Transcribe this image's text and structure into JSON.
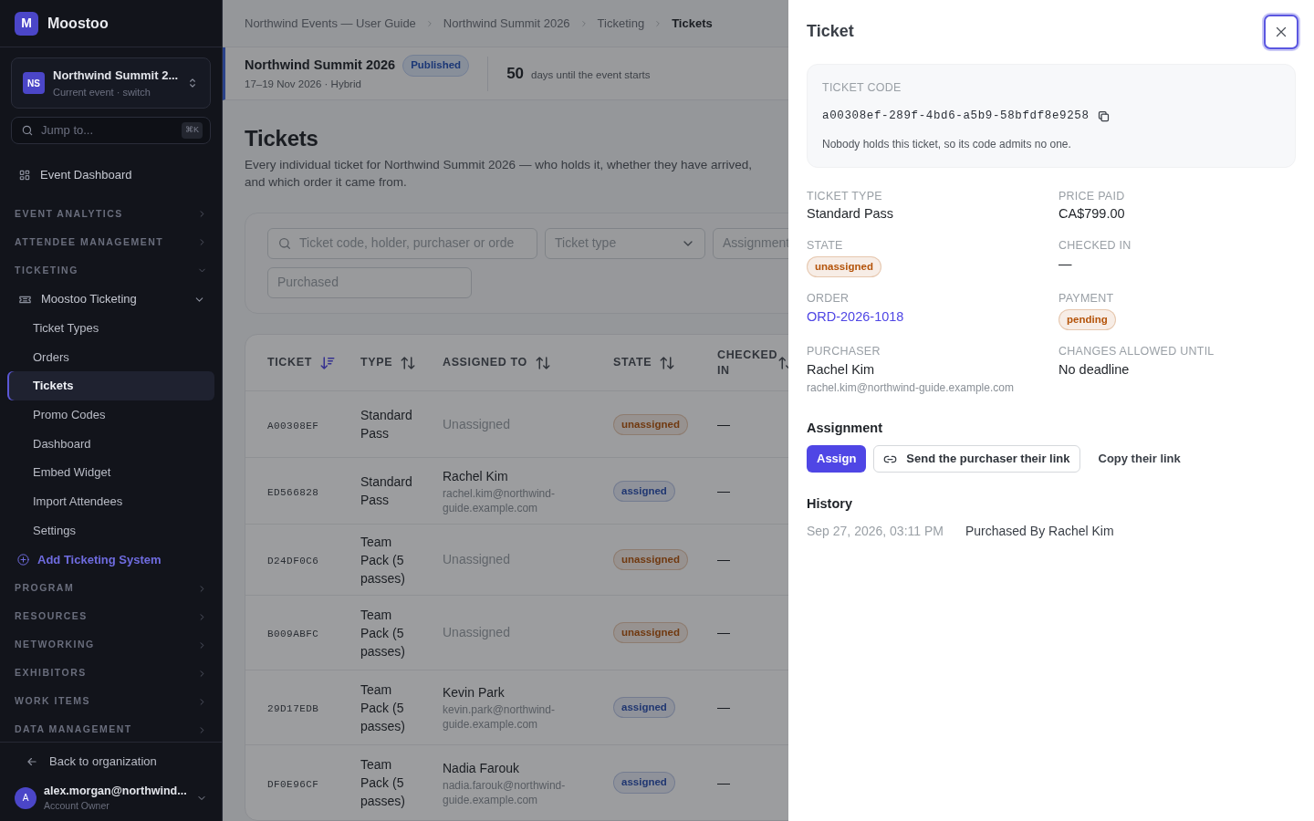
{
  "app": {
    "logo_letter": "M",
    "name": "Moostoo"
  },
  "event_switcher": {
    "initials": "NS",
    "name": "Northwind Summit 2...",
    "subtitle": "Current event · switch"
  },
  "jump": {
    "placeholder": "Jump to...",
    "shortcut": "⌘K"
  },
  "sidebar": {
    "items": [
      {
        "kind": "link",
        "label": "Event Dashboard"
      },
      {
        "kind": "section",
        "label": "EVENT ANALYTICS",
        "expanded": false
      },
      {
        "kind": "section",
        "label": "ATTENDEE MANAGEMENT",
        "expanded": false
      },
      {
        "kind": "section",
        "label": "TICKETING",
        "expanded": true,
        "children": [
          {
            "kind": "group",
            "label": "Moostoo Ticketing",
            "expanded": true,
            "children": [
              {
                "label": "Ticket Types",
                "selected": false
              },
              {
                "label": "Orders",
                "selected": false
              },
              {
                "label": "Tickets",
                "selected": true
              },
              {
                "label": "Promo Codes",
                "selected": false
              },
              {
                "label": "Dashboard",
                "selected": false
              },
              {
                "label": "Embed Widget",
                "selected": false
              },
              {
                "label": "Import Attendees",
                "selected": false
              },
              {
                "label": "Settings",
                "selected": false
              }
            ]
          },
          {
            "kind": "add",
            "label": "Add Ticketing System"
          }
        ]
      },
      {
        "kind": "section",
        "label": "PROGRAM",
        "expanded": false
      },
      {
        "kind": "section",
        "label": "RESOURCES",
        "expanded": false
      },
      {
        "kind": "section",
        "label": "NETWORKING",
        "expanded": false
      },
      {
        "kind": "section",
        "label": "EXHIBITORS",
        "expanded": false
      },
      {
        "kind": "section",
        "label": "WORK ITEMS",
        "expanded": false
      },
      {
        "kind": "section",
        "label": "DATA MANAGEMENT",
        "expanded": false
      }
    ]
  },
  "sidebar_footer": {
    "back": "Back to organization",
    "user": {
      "initial": "A",
      "email": "alex.morgan@northwind...",
      "role": "Account Owner"
    }
  },
  "breadcrumbs": [
    {
      "label": "Northwind Events — User Guide",
      "current": false
    },
    {
      "label": "Northwind Summit 2026",
      "current": false
    },
    {
      "label": "Ticketing",
      "current": false
    },
    {
      "label": "Tickets",
      "current": true
    }
  ],
  "event_bar": {
    "name": "Northwind Summit 2026",
    "status": "Published",
    "dates": "17–19 Nov 2026 · Hybrid",
    "countdown": "50",
    "countdown_label": "days until the event starts"
  },
  "page": {
    "title": "Tickets",
    "description": "Every individual ticket for Northwind Summit 2026 — who holds it, whether they have arrived, and which order it came from."
  },
  "filters": {
    "search_placeholder": "Ticket code, holder, purchaser or orde",
    "ticket_type_placeholder": "Ticket type",
    "assignment_placeholder": "Assignment",
    "purchased_placeholder": "Purchased"
  },
  "table": {
    "columns": [
      {
        "label": "TICKET",
        "sorted": true
      },
      {
        "label": "TYPE",
        "sorted": false
      },
      {
        "label": "ASSIGNED TO",
        "sorted": false
      },
      {
        "label": "STATE",
        "sorted": false
      },
      {
        "label": "CHECKED IN",
        "sorted": false
      }
    ],
    "rows": [
      {
        "code": "A00308EF",
        "type": "Standard Pass",
        "assigned": false,
        "assigned_to": "Unassigned",
        "state": "unassigned",
        "checked_in": "—"
      },
      {
        "code": "ED566828",
        "type": "Standard Pass",
        "assigned": true,
        "assigned_to": "Rachel Kim",
        "email": "rachel.kim@northwind-guide.example.com",
        "state": "assigned",
        "checked_in": "—"
      },
      {
        "code": "D24DF0C6",
        "type": "Team Pack (5 passes)",
        "assigned": false,
        "assigned_to": "Unassigned",
        "state": "unassigned",
        "checked_in": "—"
      },
      {
        "code": "B009ABFC",
        "type": "Team Pack (5 passes)",
        "assigned": false,
        "assigned_to": "Unassigned",
        "state": "unassigned",
        "checked_in": "—"
      },
      {
        "code": "29D17EDB",
        "type": "Team Pack (5 passes)",
        "assigned": true,
        "assigned_to": "Kevin Park",
        "email": "kevin.park@northwind-guide.example.com",
        "state": "assigned",
        "checked_in": "—"
      },
      {
        "code": "DF0E96CF",
        "type": "Team Pack (5 passes)",
        "assigned": true,
        "assigned_to": "Nadia Farouk",
        "email": "nadia.farouk@northwind-guide.example.com",
        "state": "assigned",
        "checked_in": "—"
      }
    ]
  },
  "drawer": {
    "title": "Ticket",
    "code_card": {
      "label": "TICKET CODE",
      "code": "a00308ef-289f-4bd6-a5b9-58bfdf8e9258",
      "note": "Nobody holds this ticket, so its code admits no one."
    },
    "details": [
      {
        "label": "TICKET TYPE",
        "kind": "text",
        "value": "Standard Pass"
      },
      {
        "label": "PRICE PAID",
        "kind": "text",
        "value": "CA$799.00"
      },
      {
        "label": "STATE",
        "kind": "badge",
        "color": "#b45309",
        "value": "unassigned"
      },
      {
        "label": "CHECKED IN",
        "kind": "text",
        "value": "—"
      },
      {
        "label": "ORDER",
        "kind": "link",
        "value": "ORD-2026-1018"
      },
      {
        "label": "PAYMENT",
        "kind": "badge",
        "color": "#b45309",
        "value": "pending"
      },
      {
        "label": "PURCHASER",
        "kind": "person",
        "value": "Rachel Kim",
        "email": "rachel.kim@northwind-guide.example.com"
      },
      {
        "label": "CHANGES ALLOWED UNTIL",
        "kind": "text",
        "value": "No deadline"
      }
    ],
    "assignment_title": "Assignment",
    "actions": [
      {
        "label": "Assign",
        "kind": "primary"
      },
      {
        "label": "Send the purchaser their link",
        "kind": "outline"
      },
      {
        "label": "Copy their link",
        "kind": "plain"
      }
    ],
    "history_title": "History",
    "history": [
      {
        "time": "Sep 27, 2026, 03:11 PM",
        "text": "Purchased By Rachel Kim"
      }
    ]
  }
}
